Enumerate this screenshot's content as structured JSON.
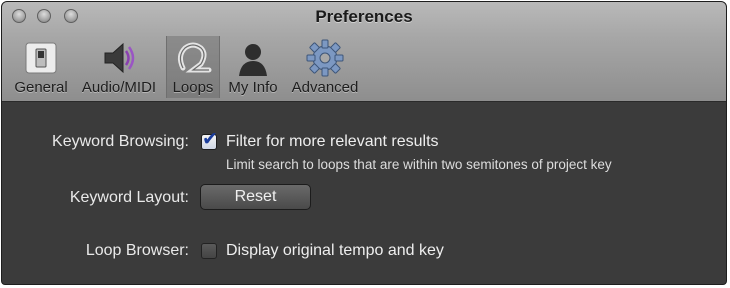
{
  "window": {
    "title": "Preferences"
  },
  "toolbar": {
    "items": [
      {
        "label": "General",
        "icon": "general-switch-icon"
      },
      {
        "label": "Audio/MIDI",
        "icon": "speaker-icon"
      },
      {
        "label": "Loops",
        "icon": "loop-icon",
        "selected": true
      },
      {
        "label": "My Info",
        "icon": "person-icon"
      },
      {
        "label": "Advanced",
        "icon": "gear-icon"
      }
    ]
  },
  "settings": {
    "keyword_browsing": {
      "label": "Keyword Browsing:",
      "checked": true,
      "option": "Filter for more relevant results",
      "description": "Limit search to loops that are within two semitones of project key"
    },
    "keyword_layout": {
      "label": "Keyword Layout:",
      "button": "Reset"
    },
    "loop_browser": {
      "label": "Loop Browser:",
      "checked": false,
      "option": "Display original tempo and key"
    }
  },
  "colors": {
    "panel": "#3b3b3b",
    "toolbar": "#a7a7a7",
    "check": "#1b3d9c"
  }
}
